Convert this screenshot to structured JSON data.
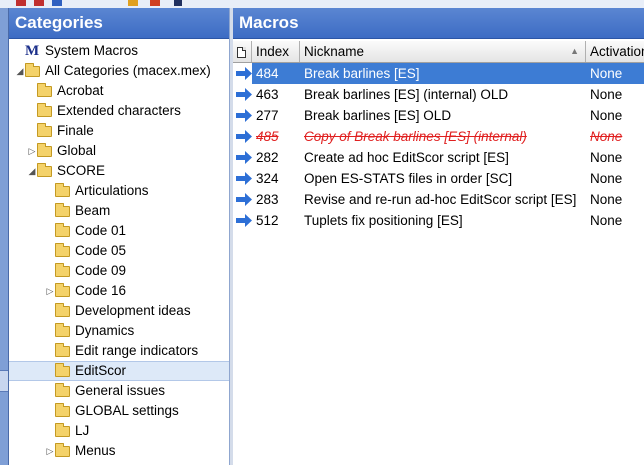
{
  "categories_panel": {
    "title": "Categories",
    "items": [
      {
        "label": "System Macros",
        "level": 0,
        "icon": "macro-logo-icon",
        "expander": ""
      },
      {
        "label": "All Categories (macex.mex)",
        "level": 0,
        "icon": "folder-open-icon",
        "expander": "◢"
      },
      {
        "label": "Acrobat",
        "level": 1,
        "icon": "folder-icon",
        "expander": ""
      },
      {
        "label": "Extended characters",
        "level": 1,
        "icon": "folder-icon",
        "expander": ""
      },
      {
        "label": "Finale",
        "level": 1,
        "icon": "folder-icon",
        "expander": ""
      },
      {
        "label": "Global",
        "level": 1,
        "icon": "folder-icon",
        "expander": "▷"
      },
      {
        "label": "SCORE",
        "level": 1,
        "icon": "folder-open-icon",
        "expander": "◢"
      },
      {
        "label": "Articulations",
        "level": 2,
        "icon": "folder-icon",
        "expander": ""
      },
      {
        "label": "Beam",
        "level": 2,
        "icon": "folder-icon",
        "expander": ""
      },
      {
        "label": "Code 01",
        "level": 2,
        "icon": "folder-icon",
        "expander": ""
      },
      {
        "label": "Code 05",
        "level": 2,
        "icon": "folder-icon",
        "expander": ""
      },
      {
        "label": "Code 09",
        "level": 2,
        "icon": "folder-icon",
        "expander": ""
      },
      {
        "label": "Code 16",
        "level": 2,
        "icon": "folder-icon",
        "expander": "▷"
      },
      {
        "label": "Development ideas",
        "level": 2,
        "icon": "folder-icon",
        "expander": ""
      },
      {
        "label": "Dynamics",
        "level": 2,
        "icon": "folder-icon",
        "expander": ""
      },
      {
        "label": "Edit range indicators",
        "level": 2,
        "icon": "folder-icon",
        "expander": ""
      },
      {
        "label": "EditScor",
        "level": 2,
        "icon": "folder-open-icon",
        "expander": "",
        "selected": true
      },
      {
        "label": "General issues",
        "level": 2,
        "icon": "folder-icon",
        "expander": ""
      },
      {
        "label": "GLOBAL settings",
        "level": 2,
        "icon": "folder-icon",
        "expander": ""
      },
      {
        "label": "LJ",
        "level": 2,
        "icon": "folder-icon",
        "expander": ""
      },
      {
        "label": "Menus",
        "level": 2,
        "icon": "folder-icon",
        "expander": "▷"
      }
    ]
  },
  "macros_panel": {
    "title": "Macros",
    "columns": {
      "index": "Index",
      "nickname": "Nickname",
      "activation": "Activation"
    },
    "rows": [
      {
        "index": "484",
        "nickname": "Break barlines [ES]",
        "activation": "None",
        "state": "selected"
      },
      {
        "index": "463",
        "nickname": "Break barlines [ES] (internal) OLD",
        "activation": "None",
        "state": "normal"
      },
      {
        "index": "277",
        "nickname": "Break barlines [ES] OLD",
        "activation": "None",
        "state": "normal"
      },
      {
        "index": "485",
        "nickname": "Copy of Break barlines [ES] (internal)",
        "activation": "None",
        "state": "disabled"
      },
      {
        "index": "282",
        "nickname": "Create ad hoc EditScor script [ES]",
        "activation": "None",
        "state": "normal"
      },
      {
        "index": "324",
        "nickname": "Open ES-STATS files in order [SC]",
        "activation": "None",
        "state": "normal"
      },
      {
        "index": "283",
        "nickname": "Revise and re-run ad-hoc EditScor script [ES]",
        "activation": "None",
        "state": "normal"
      },
      {
        "index": "512",
        "nickname": "Tuplets fix positioning [ES]",
        "activation": "None",
        "state": "normal"
      }
    ]
  },
  "colors": {
    "header_blue": "#3d6cc4",
    "selection_blue": "#3d7cd4",
    "disabled_red": "#e02020",
    "arrow_blue": "#2d6fd6"
  }
}
